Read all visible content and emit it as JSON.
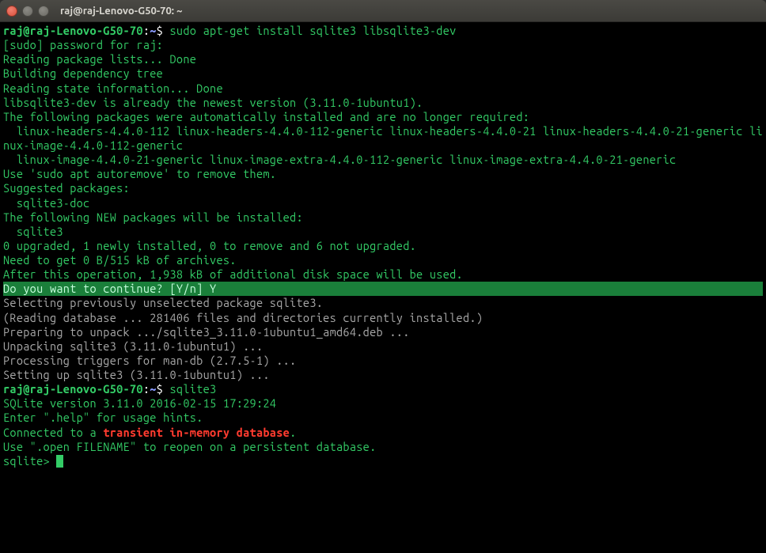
{
  "window": {
    "title": "raj@raj-Lenovo-G50-70: ~"
  },
  "prompt": {
    "user_host": "raj@raj-Lenovo-G50-70",
    "sep1": ":",
    "path": "~",
    "sep2": "$"
  },
  "cmd1": " sudo apt-get install sqlite3 libsqlite3-dev",
  "lines": {
    "l1": "[sudo] password for raj:",
    "l2": "Reading package lists... Done",
    "l3": "Building dependency tree",
    "l4": "Reading state information... Done",
    "l5": "libsqlite3-dev is already the newest version (3.11.0-1ubuntu1).",
    "l6": "The following packages were automatically installed and are no longer required:",
    "l7": "  linux-headers-4.4.0-112 linux-headers-4.4.0-112-generic linux-headers-4.4.0-21 linux-headers-4.4.0-21-generic linux-image-4.4.0-112-generic",
    "l8": "  linux-image-4.4.0-21-generic linux-image-extra-4.4.0-112-generic linux-image-extra-4.4.0-21-generic",
    "l9": "Use 'sudo apt autoremove' to remove them.",
    "l10": "Suggested packages:",
    "l11": "  sqlite3-doc",
    "l12": "The following NEW packages will be installed:",
    "l13": "  sqlite3",
    "l14": "0 upgraded, 1 newly installed, 0 to remove and 6 not upgraded.",
    "l15": "Need to get 0 B/515 kB of archives.",
    "l16": "After this operation, 1,938 kB of additional disk space will be used.",
    "l17": "Do you want to continue? [Y/n] Y",
    "l18": "Selecting previously unselected package sqlite3.",
    "l19": "(Reading database ... 281406 files and directories currently installed.)",
    "l20": "Preparing to unpack .../sqlite3_3.11.0-1ubuntu1_amd64.deb ...",
    "l21": "Unpacking sqlite3 (3.11.0-1ubuntu1) ...",
    "l22": "Processing triggers for man-db (2.7.5-1) ...",
    "l23": "Setting up sqlite3 (3.11.0-1ubuntu1) ..."
  },
  "cmd2": " sqlite3",
  "sqlite": {
    "s1": "SQLite version 3.11.0 2016-02-15 17:29:24",
    "s2": "Enter \".help\" for usage hints.",
    "s3a": "Connected to a ",
    "s3b": "transient in-memory database",
    "s3c": ".",
    "s4": "Use \".open FILENAME\" to reopen on a persistent database.",
    "prompt": "sqlite> "
  }
}
